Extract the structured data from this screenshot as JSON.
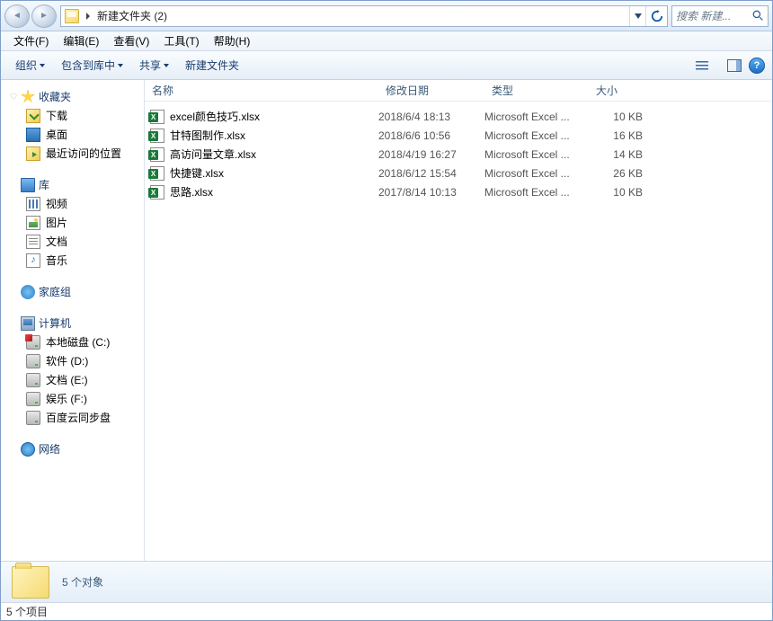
{
  "nav": {
    "breadcrumb_label": "新建文件夹 (2)"
  },
  "search": {
    "placeholder": "搜索 新建..."
  },
  "menu": {
    "file": "文件(F)",
    "edit": "编辑(E)",
    "view": "查看(V)",
    "tools": "工具(T)",
    "help": "帮助(H)"
  },
  "toolbar": {
    "organize": "组织",
    "include": "包含到库中",
    "share": "共享",
    "new_folder": "新建文件夹"
  },
  "sidebar": {
    "favorites": {
      "header": "收藏夹",
      "downloads": "下载",
      "desktop": "桌面",
      "recent": "最近访问的位置"
    },
    "libraries": {
      "header": "库",
      "videos": "视频",
      "pictures": "图片",
      "documents": "文档",
      "music": "音乐"
    },
    "homegroup": {
      "header": "家庭组"
    },
    "computer": {
      "header": "计算机",
      "drive_c": "本地磁盘 (C:)",
      "drive_d": "软件 (D:)",
      "drive_e": "文档 (E:)",
      "drive_f": "娱乐 (F:)",
      "drive_baidu": "百度云同步盘"
    },
    "network": {
      "header": "网络"
    }
  },
  "columns": {
    "name": "名称",
    "modified": "修改日期",
    "type": "类型",
    "size": "大小"
  },
  "files": [
    {
      "name": "excel颜色技巧.xlsx",
      "date": "2018/6/4 18:13",
      "type": "Microsoft Excel ...",
      "size": "10 KB"
    },
    {
      "name": "甘特图制作.xlsx",
      "date": "2018/6/6 10:56",
      "type": "Microsoft Excel ...",
      "size": "16 KB"
    },
    {
      "name": "高访问量文章.xlsx",
      "date": "2018/4/19 16:27",
      "type": "Microsoft Excel ...",
      "size": "14 KB"
    },
    {
      "name": "快捷键.xlsx",
      "date": "2018/6/12 15:54",
      "type": "Microsoft Excel ...",
      "size": "26 KB"
    },
    {
      "name": "思路.xlsx",
      "date": "2017/8/14 10:13",
      "type": "Microsoft Excel ...",
      "size": "10 KB"
    }
  ],
  "details": {
    "count_text": "5 个对象"
  },
  "status": {
    "text": "5 个项目"
  }
}
